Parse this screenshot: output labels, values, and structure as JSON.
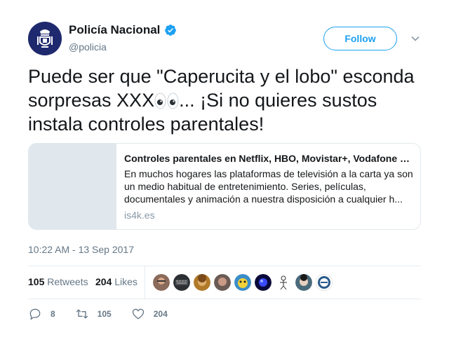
{
  "user": {
    "display_name": "Policía Nacional",
    "handle": "@policia",
    "verified": true
  },
  "follow_label": "Follow",
  "tweet": {
    "text_before": "Puede ser que \"Caperucita y el lobo\" esconda sorpresas XXX",
    "text_after": "... ¡Si no quieres sustos instala controles parentales!"
  },
  "card": {
    "title": "Controles parentales en Netflix, HBO, Movistar+, Vodafone TV...",
    "description": "En muchos hogares las plataformas de televisión a la carta ya son un medio habitual de entretenimiento. Series, películas, documentales y animación a nuestra disposición a cualquier h...",
    "domain": "is4k.es"
  },
  "timestamp": "10:22 AM - 13 Sep 2017",
  "stats": {
    "retweets_count": "105",
    "retweets_label": "Retweets",
    "likes_count": "204",
    "likes_label": "Likes"
  },
  "actions": {
    "replies": "8",
    "retweets": "105",
    "likes": "204"
  },
  "colors": {
    "accent": "#1da1f2",
    "secondary_text": "#657786",
    "border": "#e1e8ed"
  },
  "icons": [
    "police-badge-avatar",
    "verified-badge-icon",
    "chevron-down-icon",
    "eyes-emoji",
    "reply-icon",
    "retweet-icon",
    "heart-icon"
  ]
}
